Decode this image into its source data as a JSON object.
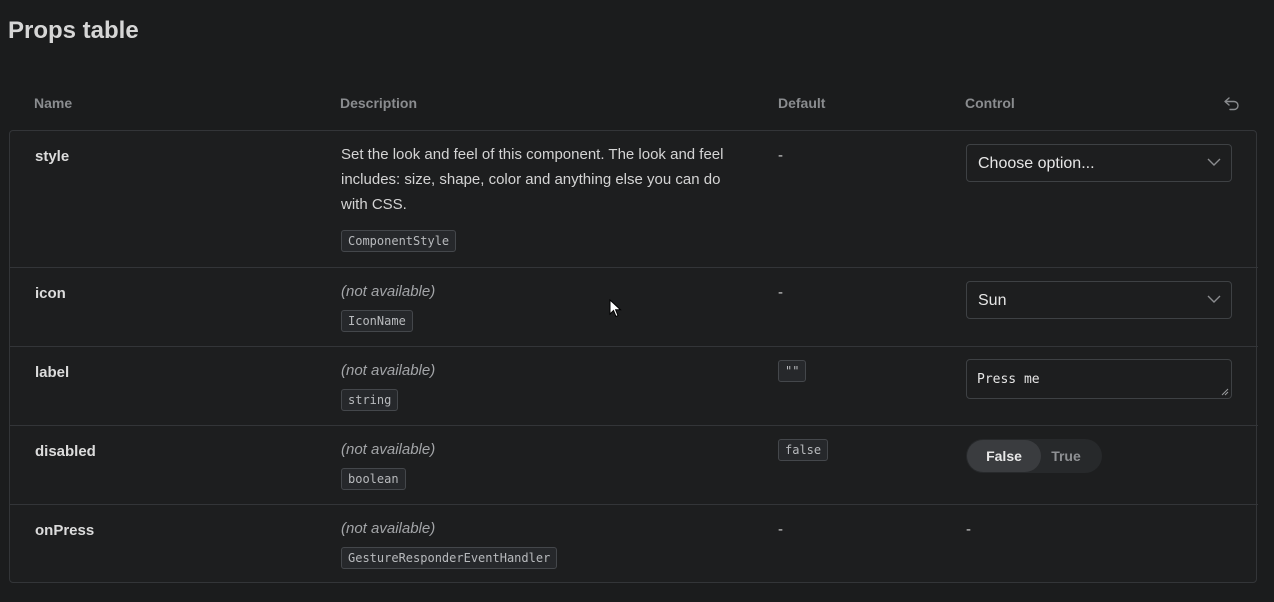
{
  "title": "Props table",
  "columns": {
    "name": "Name",
    "description": "Description",
    "default": "Default",
    "control": "Control"
  },
  "reset_icon": "undo-icon",
  "rows": [
    {
      "name": "style",
      "description": "Set the look and feel of this component. The look and feel includes: size, shape, color and anything else you can do with CSS.",
      "type": "ComponentStyle",
      "default": "-",
      "control": {
        "kind": "select",
        "value": "Choose option..."
      }
    },
    {
      "name": "icon",
      "description": "(not available)",
      "type": "IconName",
      "default": "-",
      "control": {
        "kind": "select",
        "value": "Sun"
      }
    },
    {
      "name": "label",
      "description": "(not available)",
      "type": "string",
      "default": "\"\"",
      "control": {
        "kind": "text",
        "value": "Press me"
      }
    },
    {
      "name": "disabled",
      "description": "(not available)",
      "type": "boolean",
      "default": "false",
      "control": {
        "kind": "toggle",
        "options": [
          "False",
          "True"
        ],
        "selected": "False"
      }
    },
    {
      "name": "onPress",
      "description": "(not available)",
      "type": "GestureResponderEventHandler",
      "default": "-",
      "control": {
        "kind": "none",
        "value": "-"
      }
    }
  ]
}
